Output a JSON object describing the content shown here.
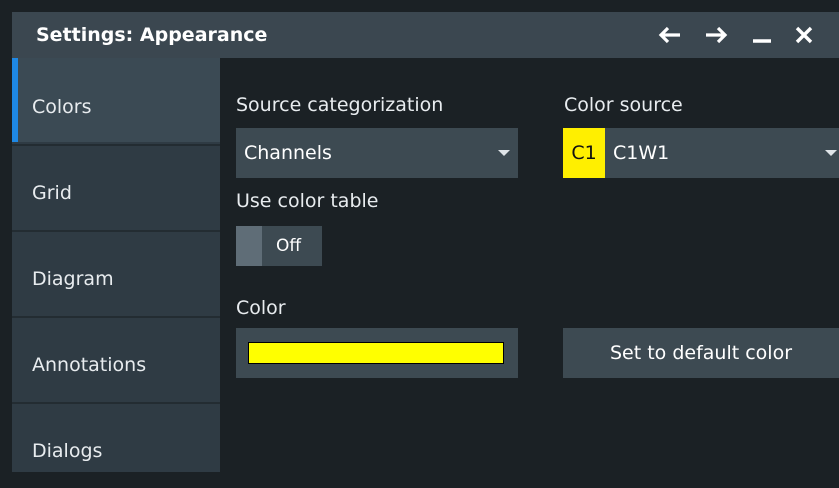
{
  "window": {
    "title": "Settings: Appearance",
    "controls": [
      "back-arrow-icon",
      "forward-arrow-icon",
      "minimize-icon",
      "close-icon"
    ]
  },
  "sidebar": {
    "items": [
      {
        "label": "Colors",
        "active": true
      },
      {
        "label": "Grid",
        "active": false
      },
      {
        "label": "Diagram",
        "active": false
      },
      {
        "label": "Annotations",
        "active": false
      },
      {
        "label": "Dialogs",
        "active": false
      }
    ]
  },
  "colors": {
    "source_categorization_label": "Source categorization",
    "source_categorization_value": "Channels",
    "color_source_label": "Color source",
    "color_source_chip": "C1",
    "color_source_value": "C1W1",
    "use_color_table_label": "Use color table",
    "use_color_table_state": "Off",
    "color_label": "Color",
    "color_value": "#ffff00",
    "set_default_label": "Set to default color"
  },
  "theme": {
    "accent": "#1e88e5",
    "chip_color": "#ffef00"
  }
}
